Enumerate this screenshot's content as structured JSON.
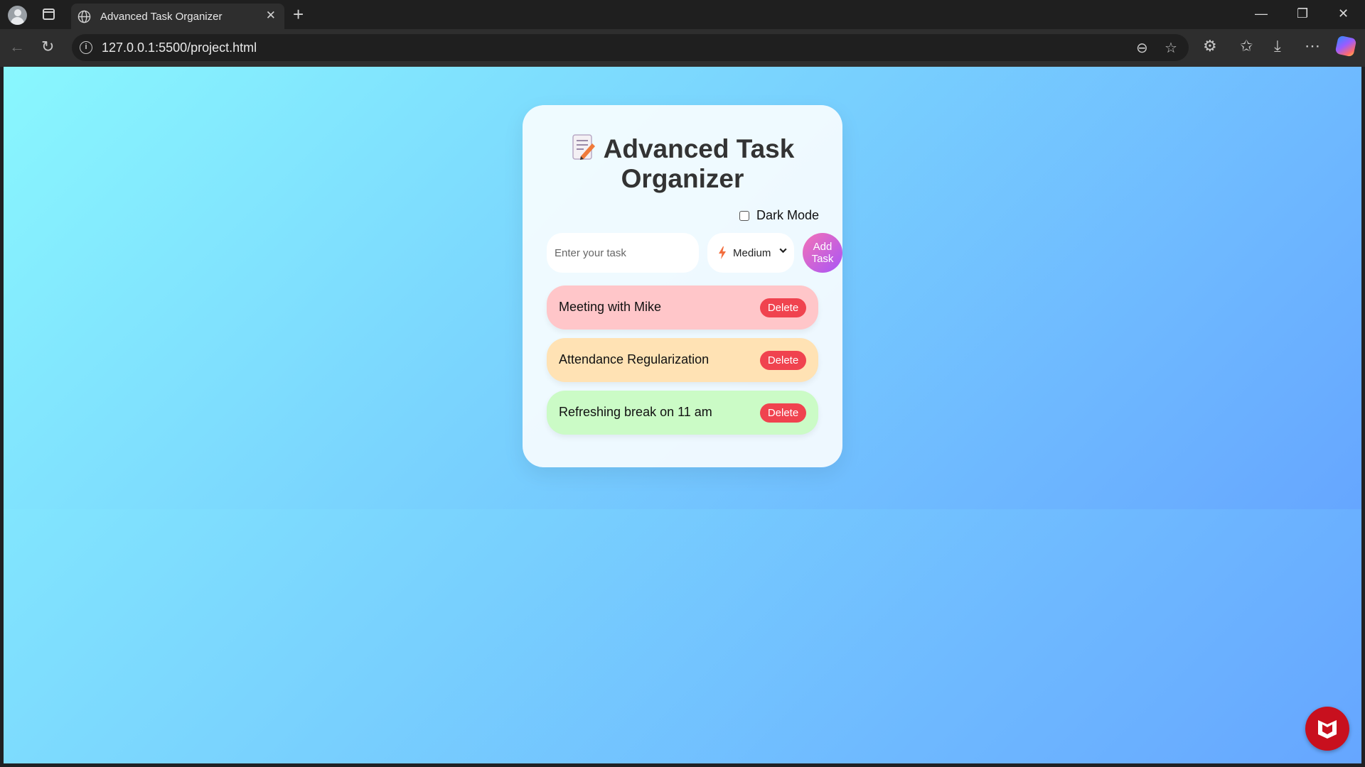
{
  "browser": {
    "tab_title": "Advanced Task Organizer",
    "tab_close": "✕",
    "new_tab": "+",
    "url": "127.0.0.1:5500/project.html",
    "window_controls": {
      "minimize": "—",
      "restore": "❐",
      "close": "✕"
    }
  },
  "app": {
    "title": "Advanced Task Organizer",
    "dark_mode_label": "Dark Mode",
    "task_input_placeholder": "Enter your task",
    "priority_selected": "Medium",
    "add_button_label": "Add Task",
    "tasks": [
      {
        "text": "Meeting with Mike",
        "priority": "high",
        "color": "#ffc6c9",
        "delete_label": "Delete"
      },
      {
        "text": "Attendance Regularization",
        "priority": "medium",
        "color": "#ffe2b4",
        "delete_label": "Delete"
      },
      {
        "text": "Refreshing break on 11 am",
        "priority": "low",
        "color": "#cbfbc6",
        "delete_label": "Delete"
      }
    ]
  },
  "colors": {
    "bg_gradient_start": "#89f7fe",
    "bg_gradient_end": "#66a6ff",
    "delete_button": "#f0434f",
    "add_button_start": "#f472b6",
    "add_button_end": "#a855f7"
  }
}
